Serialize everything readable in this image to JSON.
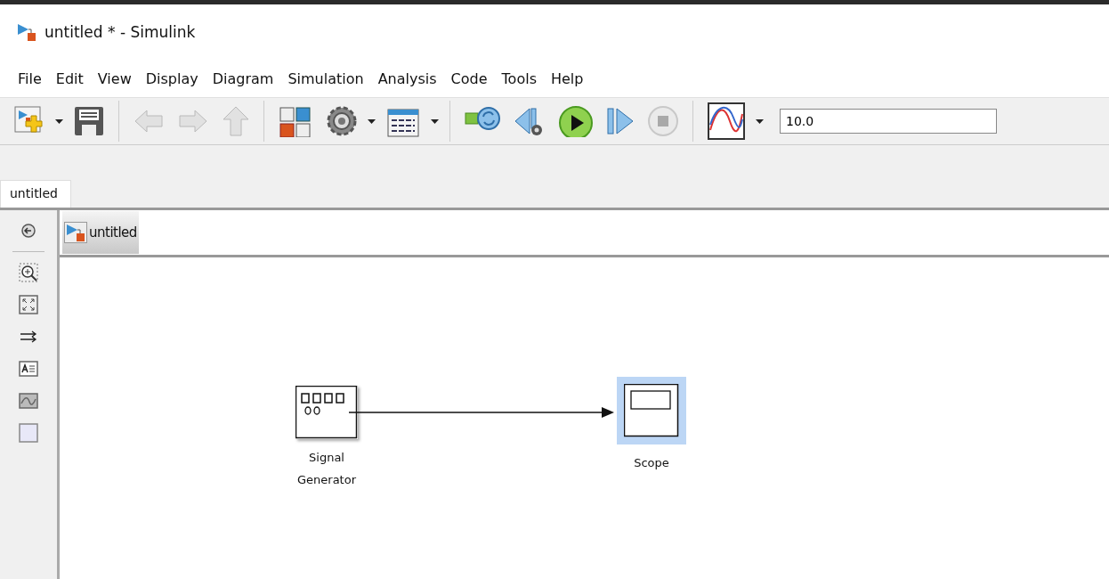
{
  "window": {
    "title": "untitled * - Simulink"
  },
  "menu": [
    "File",
    "Edit",
    "View",
    "Display",
    "Diagram",
    "Simulation",
    "Analysis",
    "Code",
    "Tools",
    "Help"
  ],
  "toolbar": [
    {
      "kind": "new-model",
      "disabled": false
    },
    {
      "kind": "caret",
      "disabled": false
    },
    {
      "kind": "save",
      "disabled": false
    },
    {
      "kind": "separator"
    },
    {
      "kind": "back",
      "disabled": true
    },
    {
      "kind": "forward",
      "disabled": true
    },
    {
      "kind": "up",
      "disabled": true
    },
    {
      "kind": "separator"
    },
    {
      "kind": "library",
      "disabled": false
    },
    {
      "kind": "gear",
      "disabled": false
    },
    {
      "kind": "caret",
      "disabled": false
    },
    {
      "kind": "config",
      "disabled": false
    },
    {
      "kind": "caret",
      "disabled": false
    },
    {
      "kind": "separator"
    },
    {
      "kind": "update",
      "disabled": false
    },
    {
      "kind": "step-back",
      "disabled": false
    },
    {
      "kind": "play",
      "disabled": false
    },
    {
      "kind": "step-forward",
      "disabled": false
    },
    {
      "kind": "stop",
      "disabled": true
    },
    {
      "kind": "separator"
    },
    {
      "kind": "scope",
      "disabled": false
    },
    {
      "kind": "caret",
      "disabled": false
    }
  ],
  "stop_time": {
    "value": "10.0"
  },
  "tabs": [
    {
      "label": "untitled",
      "selected": true
    }
  ],
  "palette": [
    {
      "kind": "hide"
    },
    {
      "kind": "zoom"
    },
    {
      "kind": "fit"
    },
    {
      "kind": "arrows"
    },
    {
      "kind": "annotation"
    },
    {
      "kind": "image"
    },
    {
      "kind": "area"
    }
  ],
  "breadcrumb": {
    "label": "untitled"
  },
  "blocks": [
    {
      "kind": "signal-generator",
      "label": "Signal Generator",
      "selected": false
    },
    {
      "kind": "scope",
      "label": "Scope",
      "selected": true
    }
  ]
}
